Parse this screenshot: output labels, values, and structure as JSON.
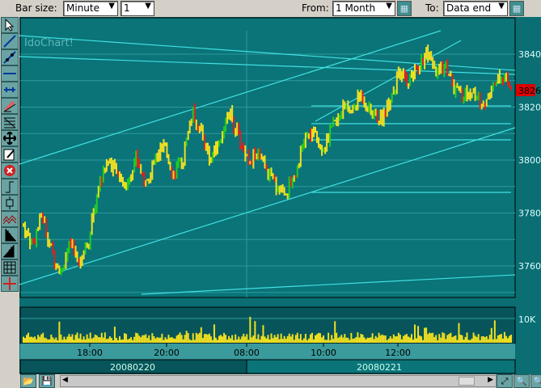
{
  "toolbar": {
    "bar_size_label": "Bar size:",
    "bar_size_value": "Minute",
    "bar_count_value": "1",
    "from_label": "From:",
    "from_value": "1 Month",
    "to_label": "To:",
    "to_value": "Data end"
  },
  "chart": {
    "watermark": "IdoChart!",
    "last_price": "3826",
    "volume_label": "10K",
    "price_ticks": [
      "3840",
      "3820",
      "3800",
      "3780",
      "3760"
    ],
    "time_ticks": [
      "18:00",
      "20:00",
      "08:00",
      "10:00",
      "12:00"
    ],
    "dates": [
      "20080220",
      "20080221"
    ]
  },
  "colors": {
    "bg": "#0a6e73",
    "panel": "#07555a",
    "line": "#3fe0e0",
    "up": "#22cc22",
    "down": "#e02020",
    "bar": "#f0e020",
    "last": "#e00000"
  },
  "chart_data": {
    "type": "candlestick",
    "ylim": [
      3750,
      3850
    ],
    "close": [
      3775,
      3768,
      3780,
      3765,
      3758,
      3768,
      3762,
      3770,
      3790,
      3800,
      3795,
      3790,
      3802,
      3790,
      3800,
      3805,
      3795,
      3800,
      3818,
      3810,
      3800,
      3808,
      3818,
      3808,
      3800,
      3802,
      3795,
      3790,
      3788,
      3795,
      3808,
      3810,
      3805,
      3812,
      3820,
      3818,
      3825,
      3818,
      3815,
      3822,
      3832,
      3830,
      3835,
      3840,
      3832,
      3836,
      3826,
      3824,
      3826,
      3820,
      3828,
      3832,
      3826
    ]
  }
}
